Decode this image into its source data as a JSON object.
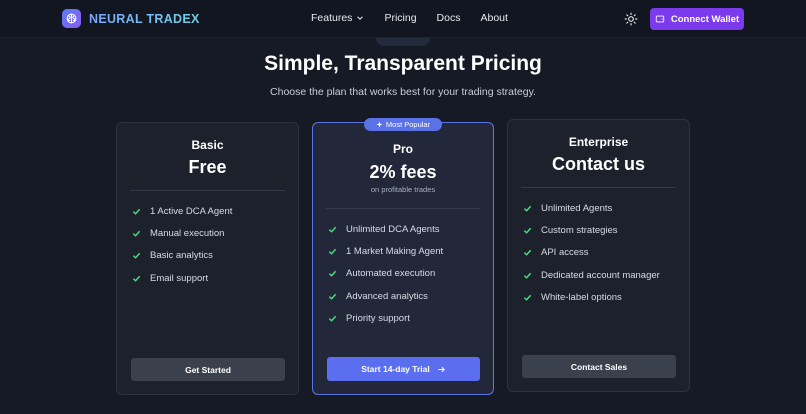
{
  "nav": {
    "brand": "NEURAL TRADEX",
    "links": [
      "Features",
      "Pricing",
      "Docs",
      "About"
    ],
    "connect_wallet": "Connect Wallet"
  },
  "hero": {
    "title": "Simple, Transparent Pricing",
    "subtitle": "Choose the plan that works best for your trading strategy."
  },
  "plans": [
    {
      "name": "Basic",
      "price": "Free",
      "features": [
        "1 Active DCA Agent",
        "Manual execution",
        "Basic analytics",
        "Email support"
      ],
      "cta": "Get Started"
    },
    {
      "badge": "Most Popular",
      "name": "Pro",
      "price": "2% fees",
      "note": "on profitable trades",
      "features": [
        "Unlimited DCA Agents",
        "1 Market Making Agent",
        "Automated execution",
        "Advanced analytics",
        "Priority support"
      ],
      "cta": "Start 14-day Trial"
    },
    {
      "name": "Enterprise",
      "price": "Contact us",
      "features": [
        "Unlimited Agents",
        "Custom strategies",
        "API access",
        "Dedicated account manager",
        "White-label options"
      ],
      "cta": "Contact Sales"
    }
  ],
  "colors": {
    "background": "#161a24",
    "accent_purple": "#7c3aed",
    "accent_blue": "#5b6ef0",
    "check_green": "#4ade80"
  },
  "icons": {
    "logo": "brain-icon",
    "theme": "sun-icon",
    "wallet": "wallet-icon",
    "badge": "sparkle-icon",
    "feature": "check-icon",
    "cta_arrow": "arrow-right-icon"
  }
}
